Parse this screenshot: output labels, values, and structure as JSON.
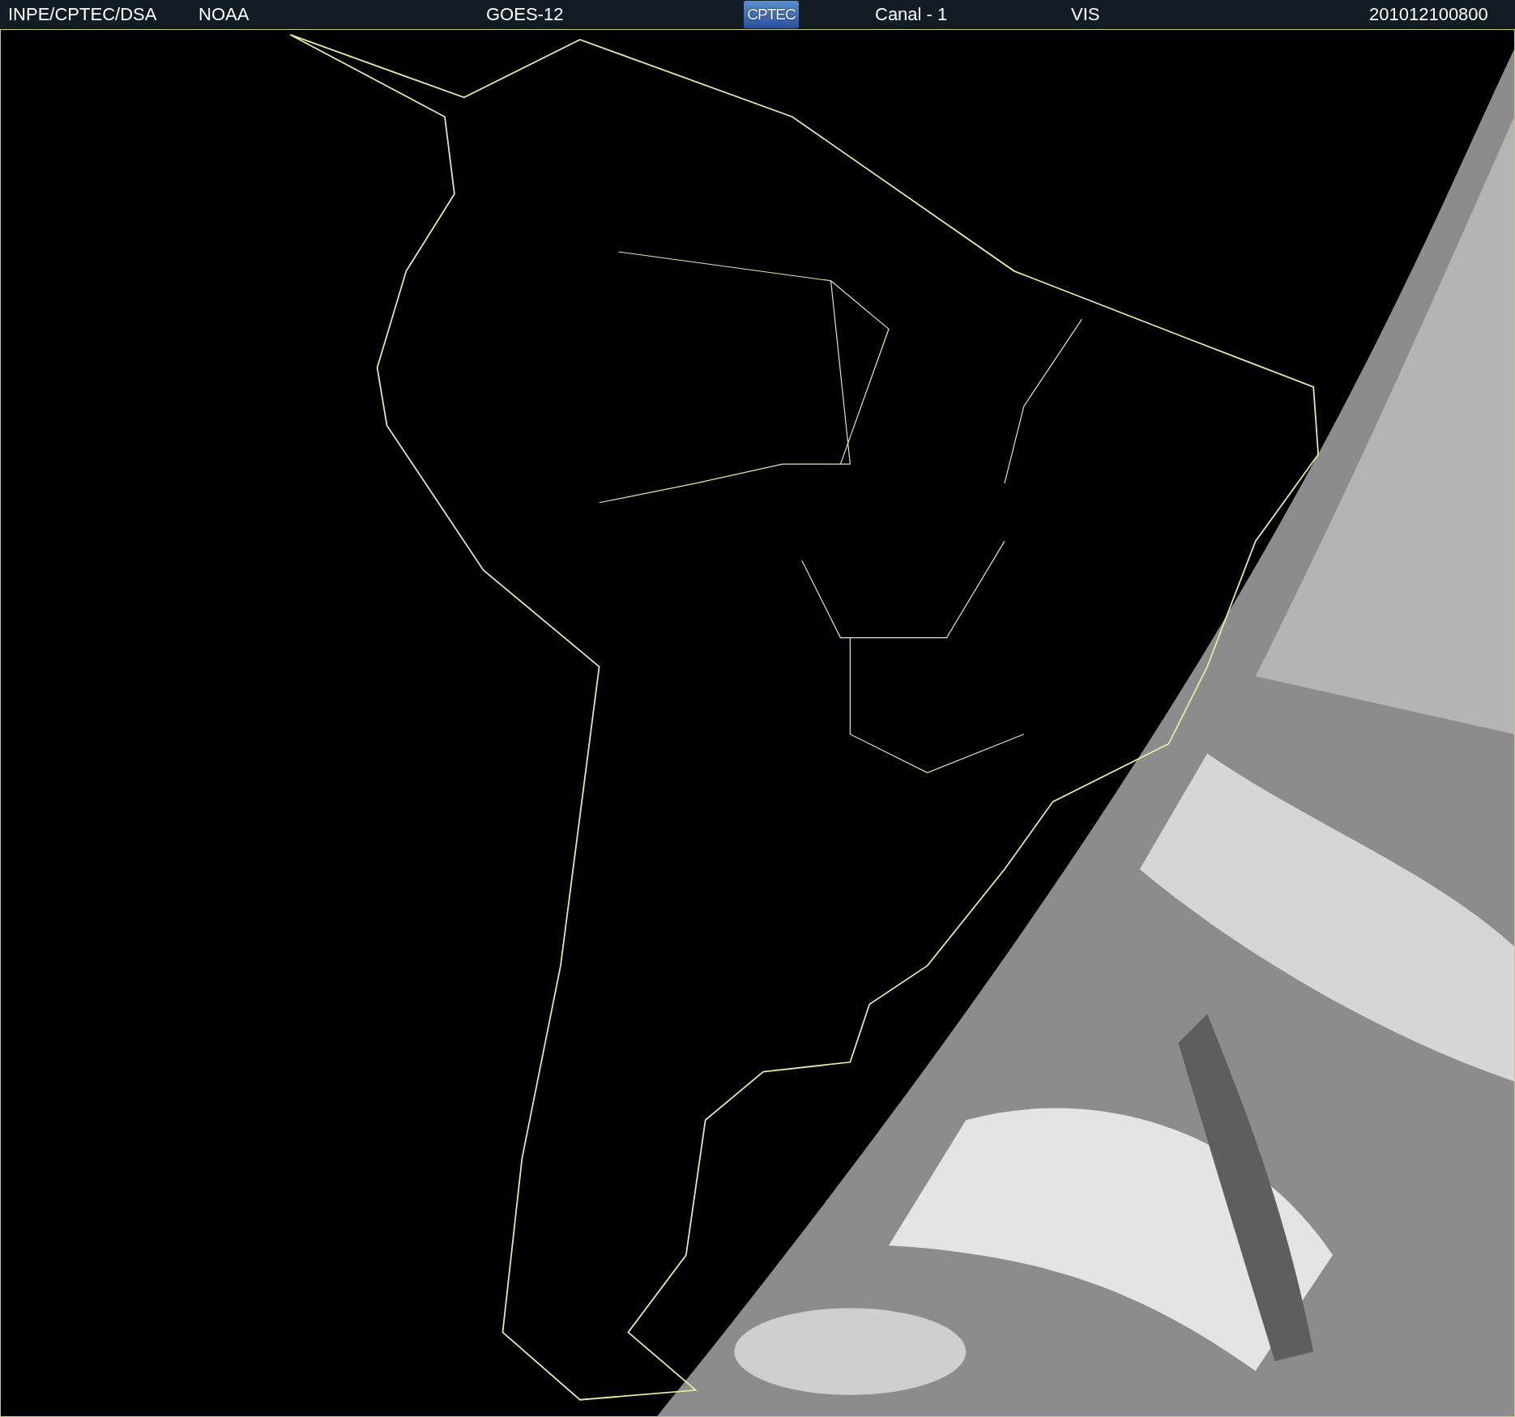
{
  "header": {
    "items": [
      {
        "kind": "text",
        "text": "INPE/CPTEC/DSA"
      },
      {
        "kind": "text",
        "text": "NOAA"
      },
      {
        "kind": "text",
        "text": "GOES-12"
      },
      {
        "kind": "logo",
        "text": "CPTEC"
      },
      {
        "kind": "text",
        "text": "Canal - 1"
      },
      {
        "kind": "text",
        "text": "VIS"
      },
      {
        "kind": "text",
        "text": "201012100800"
      }
    ]
  }
}
